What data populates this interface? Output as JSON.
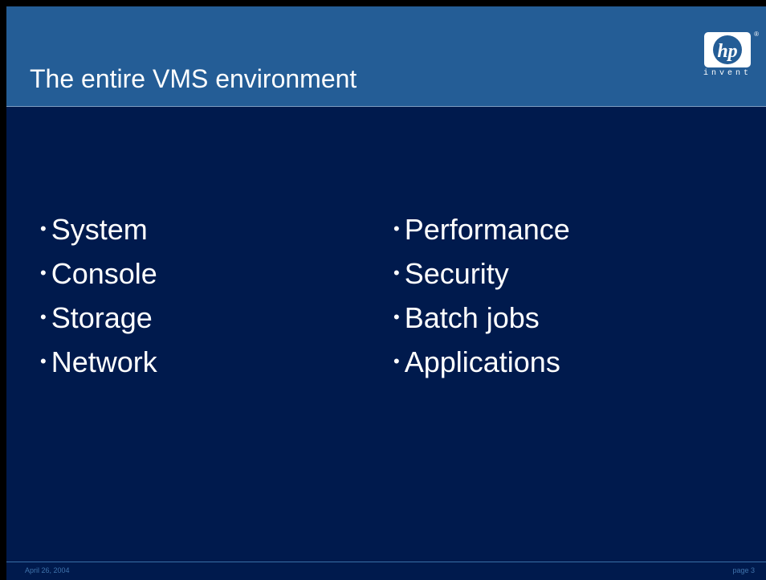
{
  "slide": {
    "title": "The entire VMS environment",
    "logo": {
      "mark_text": "hp",
      "registered": "®",
      "tagline": "invent"
    },
    "left_items": [
      "System",
      "Console",
      "Storage",
      "Network"
    ],
    "right_items": [
      "Performance",
      "Security",
      "Batch jobs",
      "Applications"
    ],
    "bullet": "•",
    "footer": {
      "date": "April 26, 2004",
      "page": "page 3"
    }
  },
  "colors": {
    "header": "#245d96",
    "body": "#001a4d",
    "footer_text": "#3f73ac"
  }
}
